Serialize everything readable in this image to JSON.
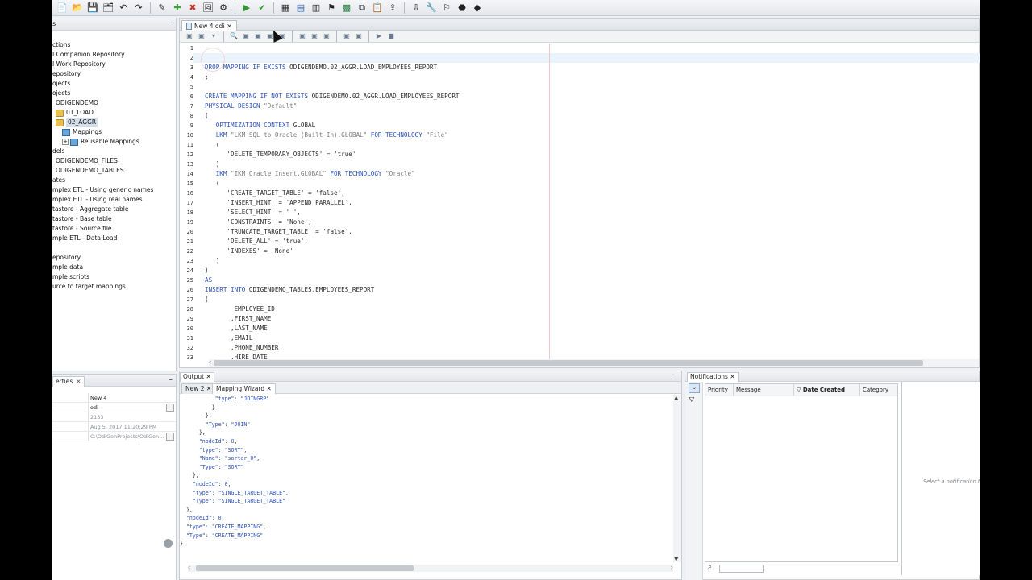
{
  "toolbar": {
    "icons": [
      "new-icon",
      "open-icon",
      "save-icon",
      "save-all-icon",
      "undo-icon",
      "redo-icon",
      "edit-icon",
      "add-icon",
      "delete-icon",
      "image-icon",
      "tools-icon",
      "run-icon",
      "check-icon",
      "grid-icon",
      "table-icon",
      "report-icon",
      "debug-icon",
      "excel-icon",
      "copy-icon",
      "paste-icon",
      "export-icon",
      "import-icon",
      "wrench-icon",
      "flag-icon",
      "plugin-icon",
      "cube-icon"
    ]
  },
  "navigator": {
    "title": "s",
    "items": [
      {
        "label": "ctions",
        "indent": 0,
        "icon": ""
      },
      {
        "label": "I Companion Repository",
        "indent": 0,
        "icon": ""
      },
      {
        "label": "I Work Repository",
        "indent": 0,
        "icon": ""
      },
      {
        "label": "epository",
        "indent": 0,
        "icon": ""
      },
      {
        "label": "ojects",
        "indent": 0,
        "icon": ""
      },
      {
        "label": "ojects",
        "indent": 0,
        "icon": ""
      },
      {
        "label": "ODIGENDEMO",
        "indent": 1,
        "icon": ""
      },
      {
        "label": "01_LOAD",
        "indent": 1,
        "icon": "folder"
      },
      {
        "label": "02_AGGR",
        "indent": 1,
        "icon": "folder",
        "selected": true
      },
      {
        "label": "Mappings",
        "indent": 2,
        "icon": "map"
      },
      {
        "label": "Reusable Mappings",
        "indent": 2,
        "icon": "map",
        "expander": "+"
      },
      {
        "label": "dels",
        "indent": 0,
        "icon": ""
      },
      {
        "label": "ODIGENDEMO_FILES",
        "indent": 1,
        "icon": ""
      },
      {
        "label": "ODIGENDEMO_TABLES",
        "indent": 1,
        "icon": ""
      },
      {
        "label": "ates",
        "indent": 0,
        "icon": ""
      },
      {
        "label": "mplex ETL - Using  generic names",
        "indent": 0,
        "icon": ""
      },
      {
        "label": "mplex ETL - Using real names",
        "indent": 0,
        "icon": ""
      },
      {
        "label": "tastore - Aggregate table",
        "indent": 0,
        "icon": ""
      },
      {
        "label": "tastore - Base table",
        "indent": 0,
        "icon": ""
      },
      {
        "label": "tastore - Source file",
        "indent": 0,
        "icon": ""
      },
      {
        "label": "mple ETL - Data Load",
        "indent": 0,
        "icon": ""
      },
      {
        "label": "",
        "indent": 0,
        "icon": ""
      },
      {
        "label": "epository",
        "indent": 0,
        "icon": ""
      },
      {
        "label": "mple data",
        "indent": 0,
        "icon": ""
      },
      {
        "label": "mple scripts",
        "indent": 0,
        "icon": ""
      },
      {
        "label": "urce to target mappings",
        "indent": 0,
        "icon": ""
      }
    ]
  },
  "properties": {
    "tab_label": "erties",
    "rows": [
      {
        "value": "New 4",
        "dim": false,
        "dots": false
      },
      {
        "value": "odi",
        "dim": false,
        "dots": true
      },
      {
        "value": "2133",
        "dim": true,
        "dots": false
      },
      {
        "value": "Aug 5, 2017 11:20:29 PM",
        "dim": true,
        "dots": false
      },
      {
        "value": "C:\\OdiGenProjects\\OdiGen...",
        "dim": true,
        "dots": true
      }
    ]
  },
  "editor": {
    "tab_label": "New 4.odi",
    "line_numbers": [
      "1",
      "2",
      "3",
      "4",
      "5",
      "6",
      "7",
      "8",
      "9",
      "10",
      "11",
      "12",
      "13",
      "14",
      "15",
      "16",
      "17",
      "18",
      "19",
      "20",
      "21",
      "22",
      "23",
      "24",
      "25",
      "26",
      "27",
      "28",
      "29",
      "30",
      "31",
      "32",
      "33"
    ],
    "lines": [
      [],
      [],
      [
        {
          "t": "DROP MAPPING IF EXISTS ",
          "c": "kw"
        },
        {
          "t": "ODIGENDEMO.02_AGGR.LOAD_EMPLOYEES_REPORT",
          "c": "plain"
        }
      ],
      [
        {
          "t": ";",
          "c": "plain"
        }
      ],
      [],
      [
        {
          "t": "CREATE MAPPING IF NOT EXISTS ",
          "c": "kw"
        },
        {
          "t": "ODIGENDEMO.02_AGGR.LOAD_EMPLOYEES_REPORT",
          "c": "plain"
        }
      ],
      [
        {
          "t": "PHYSICAL DESIGN ",
          "c": "kw"
        },
        {
          "t": "\"Default\"",
          "c": "str"
        }
      ],
      [
        {
          "t": "(",
          "c": "plain"
        }
      ],
      [
        {
          "t": "   OPTIMIZATION CONTEXT ",
          "c": "kw"
        },
        {
          "t": "GLOBAL",
          "c": "plain"
        }
      ],
      [
        {
          "t": "   LKM ",
          "c": "kw"
        },
        {
          "t": "\"LKM SQL to Oracle (Built-In).GLOBAL\"",
          "c": "str"
        },
        {
          "t": " FOR TECHNOLOGY ",
          "c": "kw"
        },
        {
          "t": "\"File\"",
          "c": "str"
        }
      ],
      [
        {
          "t": "   (",
          "c": "plain"
        }
      ],
      [
        {
          "t": "      'DELETE_TEMPORARY_OBJECTS' = 'true'",
          "c": "plain"
        }
      ],
      [
        {
          "t": "   )",
          "c": "plain"
        }
      ],
      [
        {
          "t": "   IKM ",
          "c": "kw"
        },
        {
          "t": "\"IKM Oracle Insert.GLOBAL\"",
          "c": "str"
        },
        {
          "t": " FOR TECHNOLOGY ",
          "c": "kw"
        },
        {
          "t": "\"Oracle\"",
          "c": "str"
        }
      ],
      [
        {
          "t": "   (",
          "c": "plain"
        }
      ],
      [
        {
          "t": "      'CREATE_TARGET_TABLE' = 'false',",
          "c": "plain"
        }
      ],
      [
        {
          "t": "      'INSERT_HINT' = 'APPEND PARALLEL',",
          "c": "plain"
        }
      ],
      [
        {
          "t": "      'SELECT_HINT' = ' ',",
          "c": "plain"
        }
      ],
      [
        {
          "t": "      'CONSTRAINTS' = 'None',",
          "c": "plain"
        }
      ],
      [
        {
          "t": "      'TRUNCATE_TARGET_TABLE' = 'false',",
          "c": "plain"
        }
      ],
      [
        {
          "t": "      'DELETE_ALL' = 'true',",
          "c": "plain"
        }
      ],
      [
        {
          "t": "      'INDEXES' = 'None'",
          "c": "plain"
        }
      ],
      [
        {
          "t": "   )",
          "c": "plain"
        }
      ],
      [
        {
          "t": ")",
          "c": "plain"
        }
      ],
      [
        {
          "t": "AS",
          "c": "kw"
        }
      ],
      [
        {
          "t": "INSERT INTO ",
          "c": "kw"
        },
        {
          "t": "ODIGENDEMO_TABLES.EMPLOYEES_REPORT",
          "c": "plain"
        }
      ],
      [
        {
          "t": "(",
          "c": "plain"
        }
      ],
      [
        {
          "t": "        EMPLOYEE_ID",
          "c": "plain"
        }
      ],
      [
        {
          "t": "       ,FIRST_NAME",
          "c": "plain"
        }
      ],
      [
        {
          "t": "       ,LAST_NAME",
          "c": "plain"
        }
      ],
      [
        {
          "t": "       ,EMAIL",
          "c": "plain"
        }
      ],
      [
        {
          "t": "       ,PHONE_NUMBER",
          "c": "plain"
        }
      ],
      [
        {
          "t": "       ,HIRE_DATE",
          "c": "plain"
        }
      ]
    ]
  },
  "output": {
    "title": "Output",
    "tabs": [
      "New 2",
      "Mapping Wizard"
    ],
    "lines": [
      [
        {
          "t": "           \"type\": \"JOINGRP\"",
          "c": "s"
        }
      ],
      [
        {
          "t": "          }",
          "c": "plain"
        }
      ],
      [
        {
          "t": "        },",
          "c": "plain"
        }
      ],
      [
        {
          "t": "        \"Type\": \"JOIN\"",
          "c": "s"
        }
      ],
      [
        {
          "t": "      },",
          "c": "plain"
        }
      ],
      [
        {
          "t": "      \"nodeId\": 0,",
          "c": "s"
        }
      ],
      [
        {
          "t": "      \"type\": \"SORT\",",
          "c": "s"
        }
      ],
      [
        {
          "t": "      \"Name\": \"sorter_0\",",
          "c": "s"
        }
      ],
      [
        {
          "t": "      \"Type\": \"SORT\"",
          "c": "s"
        }
      ],
      [
        {
          "t": "    },",
          "c": "plain"
        }
      ],
      [
        {
          "t": "    \"nodeId\": 0,",
          "c": "s"
        }
      ],
      [
        {
          "t": "    \"type\": \"SINGLE_TARGET_TABLE\",",
          "c": "s"
        }
      ],
      [
        {
          "t": "    \"Type\": \"SINGLE_TARGET_TABLE\"",
          "c": "s"
        }
      ],
      [
        {
          "t": "  },",
          "c": "plain"
        }
      ],
      [
        {
          "t": "  \"nodeId\": 0,",
          "c": "s"
        }
      ],
      [
        {
          "t": "  \"type\": \"CREATE_MAPPING\",",
          "c": "s"
        }
      ],
      [
        {
          "t": "  \"Type\": \"CREATE_MAPPING\"",
          "c": "s"
        }
      ],
      [
        {
          "t": "}",
          "c": "plain"
        }
      ]
    ]
  },
  "notifications": {
    "title": "Notifications",
    "columns": [
      "Priority",
      "Message",
      "Date Created",
      "Category"
    ],
    "sort_indicator": "▽",
    "detail_placeholder": "Select a notification to"
  }
}
